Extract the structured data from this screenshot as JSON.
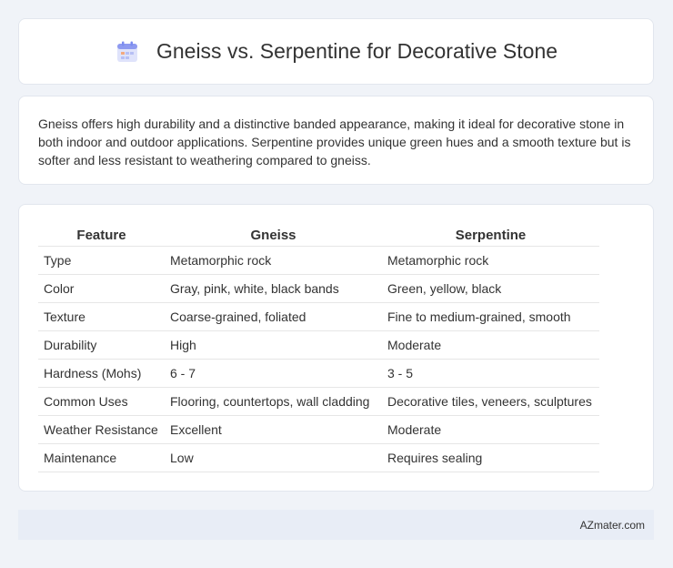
{
  "header": {
    "title": "Gneiss vs. Serpentine for Decorative Stone",
    "icon": "calendar-icon"
  },
  "description": "Gneiss offers high durability and a distinctive banded appearance, making it ideal for decorative stone in both indoor and outdoor applications. Serpentine provides unique green hues and a smooth texture but is softer and less resistant to weathering compared to gneiss.",
  "table": {
    "headers": [
      "Feature",
      "Gneiss",
      "Serpentine"
    ],
    "rows": [
      [
        "Type",
        "Metamorphic rock",
        "Metamorphic rock"
      ],
      [
        "Color",
        "Gray, pink, white, black bands",
        "Green, yellow, black"
      ],
      [
        "Texture",
        "Coarse-grained, foliated",
        "Fine to medium-grained, smooth"
      ],
      [
        "Durability",
        "High",
        "Moderate"
      ],
      [
        "Hardness (Mohs)",
        "6 - 7",
        "3 - 5"
      ],
      [
        "Common Uses",
        "Flooring, countertops, wall cladding",
        "Decorative tiles, veneers, sculptures"
      ],
      [
        "Weather Resistance",
        "Excellent",
        "Moderate"
      ],
      [
        "Maintenance",
        "Low",
        "Requires sealing"
      ]
    ]
  },
  "footer": {
    "brand": "AZmater.com"
  },
  "colors": {
    "background": "#f0f3f8",
    "card": "#ffffff",
    "footer": "#e8edf6",
    "icon_accent": "#7b8cf0"
  }
}
